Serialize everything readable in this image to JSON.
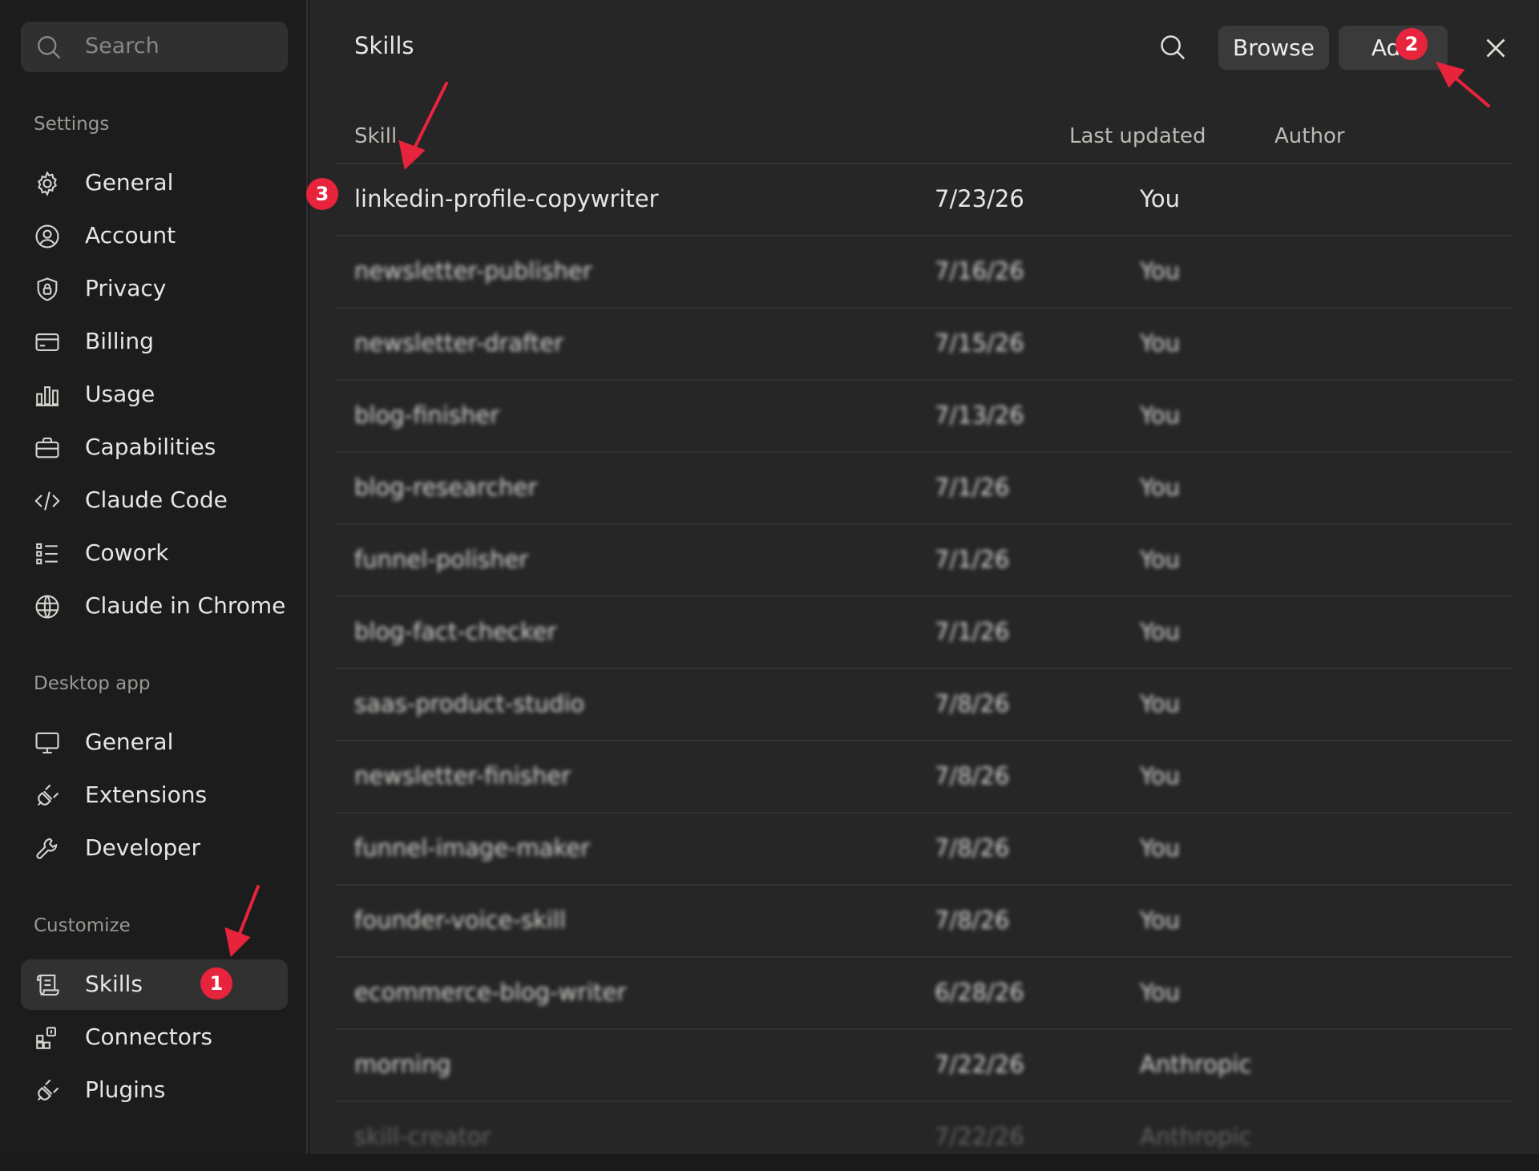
{
  "sidebar": {
    "search_placeholder": "Search",
    "sections": [
      {
        "label": "Settings"
      },
      {
        "label": "Desktop app"
      },
      {
        "label": "Customize"
      }
    ],
    "settings_items": [
      {
        "label": "General",
        "icon": "gear-icon"
      },
      {
        "label": "Account",
        "icon": "user-circle-icon"
      },
      {
        "label": "Privacy",
        "icon": "shield-lock-icon"
      },
      {
        "label": "Billing",
        "icon": "credit-card-icon"
      },
      {
        "label": "Usage",
        "icon": "bar-chart-icon"
      },
      {
        "label": "Capabilities",
        "icon": "briefcase-icon"
      },
      {
        "label": "Claude Code",
        "icon": "code-icon"
      },
      {
        "label": "Cowork",
        "icon": "checklist-icon"
      },
      {
        "label": "Claude in Chrome",
        "icon": "globe-icon"
      }
    ],
    "desktop_items": [
      {
        "label": "General",
        "icon": "monitor-icon"
      },
      {
        "label": "Extensions",
        "icon": "plug-icon"
      },
      {
        "label": "Developer",
        "icon": "wrench-icon"
      }
    ],
    "customize_items": [
      {
        "label": "Skills",
        "icon": "scroll-icon",
        "active": true
      },
      {
        "label": "Connectors",
        "icon": "grid-plus-icon"
      },
      {
        "label": "Plugins",
        "icon": "plug-icon"
      }
    ]
  },
  "main": {
    "title": "Skills",
    "browse_label": "Browse",
    "add_label": "Add",
    "columns": {
      "skill": "Skill",
      "updated": "Last updated",
      "author": "Author"
    },
    "rows": [
      {
        "skill": "linkedin-profile-copywriter",
        "date": "7/23/26",
        "author": "You",
        "blurred": false
      },
      {
        "skill": "newsletter-publisher",
        "date": "7/16/26",
        "author": "You",
        "blurred": true
      },
      {
        "skill": "newsletter-drafter",
        "date": "7/15/26",
        "author": "You",
        "blurred": true
      },
      {
        "skill": "blog-finisher",
        "date": "7/13/26",
        "author": "You",
        "blurred": true
      },
      {
        "skill": "blog-researcher",
        "date": "7/1/26",
        "author": "You",
        "blurred": true
      },
      {
        "skill": "funnel-polisher",
        "date": "7/1/26",
        "author": "You",
        "blurred": true
      },
      {
        "skill": "blog-fact-checker",
        "date": "7/1/26",
        "author": "You",
        "blurred": true
      },
      {
        "skill": "saas-product-studio",
        "date": "7/8/26",
        "author": "You",
        "blurred": true
      },
      {
        "skill": "newsletter-finisher",
        "date": "7/8/26",
        "author": "You",
        "blurred": true
      },
      {
        "skill": "funnel-image-maker",
        "date": "7/8/26",
        "author": "You",
        "blurred": true
      },
      {
        "skill": "founder-voice-skill",
        "date": "7/8/26",
        "author": "You",
        "blurred": true
      },
      {
        "skill": "ecommerce-blog-writer",
        "date": "6/28/26",
        "author": "You",
        "blurred": true
      },
      {
        "skill": "morning",
        "date": "7/22/26",
        "author": "Anthropic",
        "blurred": true
      },
      {
        "skill": "skill-creator",
        "date": "7/22/26",
        "author": "Anthropic",
        "blurred": true
      }
    ]
  },
  "annotations": {
    "badge1": "1",
    "badge2": "2",
    "badge3": "3",
    "color": "#e8243c"
  }
}
